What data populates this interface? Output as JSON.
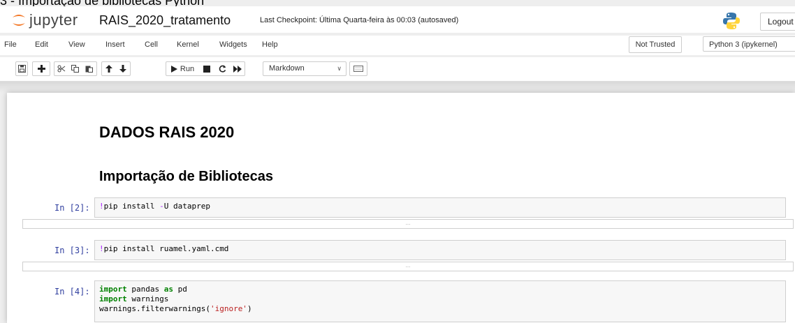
{
  "caption": "3 - Importação de bibliotecas Python",
  "header": {
    "logo_text": "jupyter",
    "notebook_title": "RAIS_2020_tratamento",
    "checkpoint": "Last Checkpoint: Última Quarta-feira às 00:03  (autosaved)",
    "logout_label": "Logout"
  },
  "menu": {
    "items": [
      "File",
      "Edit",
      "View",
      "Insert",
      "Cell",
      "Kernel",
      "Widgets",
      "Help"
    ],
    "trusted_label": "Not Trusted",
    "kernel_label": "Python 3 (ipykernel)"
  },
  "toolbar": {
    "run_label": "Run",
    "cell_type": "Markdown",
    "icons": [
      "save-icon",
      "plus-icon",
      "cut-icon",
      "copy-icon",
      "paste-icon",
      "arrow-up-icon",
      "arrow-down-icon",
      "run-icon",
      "stop-icon",
      "restart-icon",
      "fast-forward-icon",
      "keyboard-icon"
    ]
  },
  "notebook": {
    "heading1": "DADOS RAIS 2020",
    "heading2": "Importação de Bibliotecas",
    "cells": [
      {
        "prompt": "In [2]:",
        "lines": [
          [
            {
              "t": "!",
              "c": "bang"
            },
            {
              "t": "pip install ",
              "c": ""
            },
            {
              "t": "-",
              "c": "flag"
            },
            {
              "t": "U dataprep",
              "c": ""
            }
          ]
        ],
        "output_collapsed": "..."
      },
      {
        "prompt": "In [3]:",
        "lines": [
          [
            {
              "t": "!",
              "c": "bang"
            },
            {
              "t": "pip install ruamel.yaml.cmd",
              "c": ""
            }
          ]
        ],
        "output_collapsed": "..."
      },
      {
        "prompt": "In [4]:",
        "lines": [
          [
            {
              "t": "import",
              "c": "kw"
            },
            {
              "t": " pandas ",
              "c": ""
            },
            {
              "t": "as",
              "c": "kw"
            },
            {
              "t": " pd",
              "c": ""
            }
          ],
          [
            {
              "t": "import",
              "c": "kw"
            },
            {
              "t": " warnings",
              "c": ""
            }
          ],
          [
            {
              "t": "warnings.filterwarnings(",
              "c": ""
            },
            {
              "t": "'ignore'",
              "c": "str"
            },
            {
              "t": ")",
              "c": ""
            }
          ]
        ]
      }
    ]
  }
}
